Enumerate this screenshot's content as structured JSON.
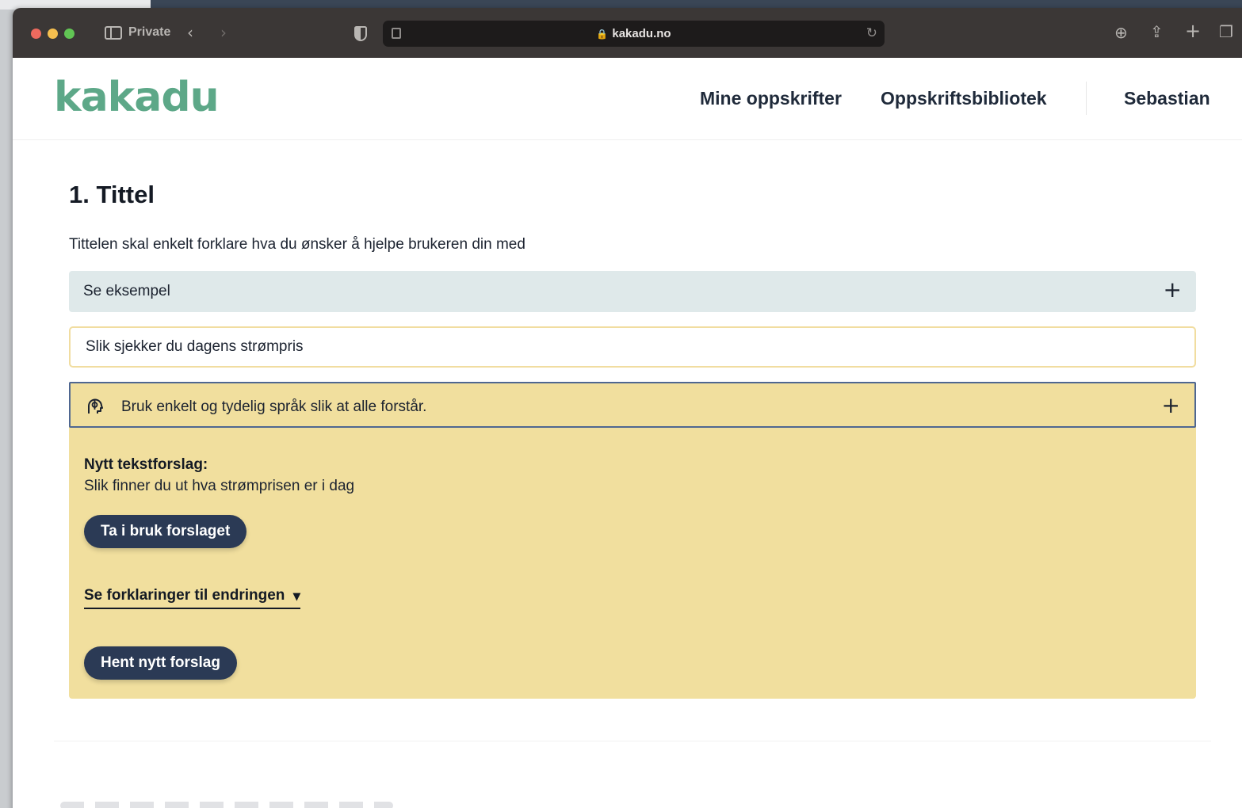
{
  "browser": {
    "private_label": "Private",
    "url": "kakadu.no",
    "icons": [
      "sidebar-icon",
      "back-icon",
      "forward-icon",
      "shield-icon",
      "lock-icon",
      "reload-icon",
      "download-icon",
      "share-icon",
      "new-tab-icon",
      "tabs-overview-icon"
    ]
  },
  "site": {
    "logo": "kakadu",
    "nav": {
      "my_recipes": "Mine oppskrifter",
      "library": "Oppskriftsbibliotek",
      "user": "Sebastian"
    }
  },
  "section": {
    "title": "1. Tittel",
    "description": "Tittelen skal enkelt forklare hva du ønsker å hjelpe brukeren din med",
    "example_label": "Se eksempel",
    "title_value": "Slik sjekker du dagens strømpris"
  },
  "suggestion": {
    "tip": "Bruk enkelt og tydelig språk slik at alle forstår.",
    "new_label": "Nytt tekstforslag:",
    "new_text": "Slik finner du ut hva strømprisen er i dag",
    "use_button": "Ta i bruk forslaget",
    "explain_link": "Se forklaringer til endringen",
    "fetch_button": "Hent nytt forslag"
  },
  "colors": {
    "brand_green": "#5da888",
    "panel_yellow": "#f1df9e",
    "accordion_blue": "#dfe9ea",
    "button_navy": "#2b3a55"
  }
}
